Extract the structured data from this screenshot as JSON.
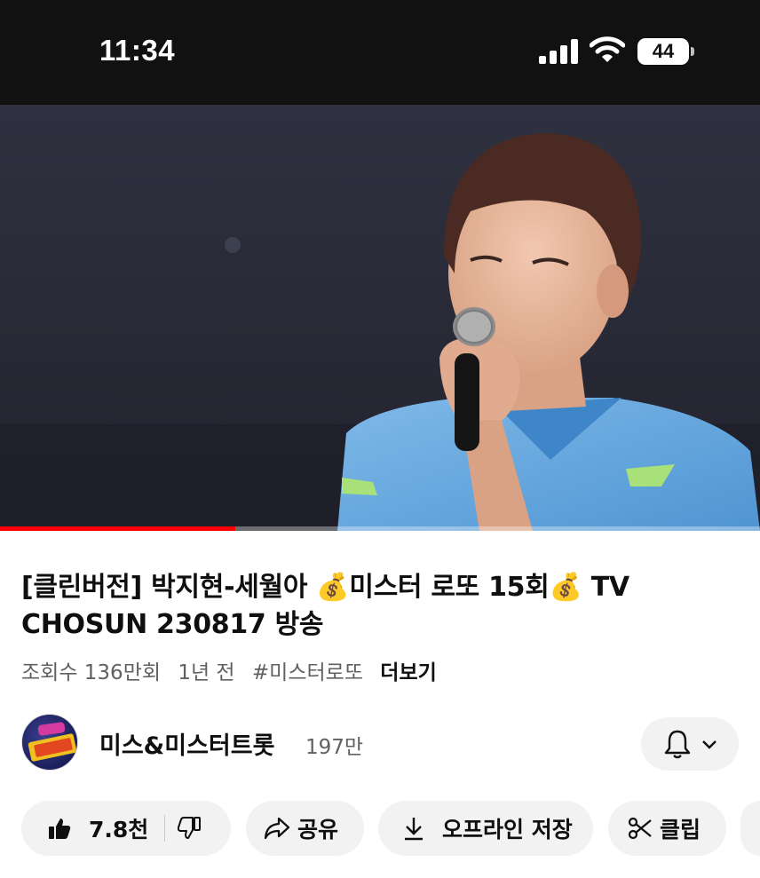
{
  "status_bar": {
    "time": "11:34",
    "battery": "44",
    "icons": [
      "cellular-signal-icon",
      "wifi-icon",
      "battery-icon"
    ]
  },
  "player": {
    "progress_fraction": 0.31,
    "progress_color": "#ff0000"
  },
  "video": {
    "title": "[클린버전] 박지현-세월아 💰미스터 로또 15회💰 TV CHOSUN 230817 방송",
    "views": "조회수 136만회",
    "age": "1년 전",
    "hashtag": "#미스터로또",
    "more": "더보기"
  },
  "channel": {
    "name": "미스&미스터트롯",
    "subscribers": "197만",
    "icons": [
      "channel-avatar",
      "bell-icon",
      "chevron-down-icon"
    ]
  },
  "actions": {
    "likes": "7.8천",
    "share": "공유",
    "download": "오프라인 저장",
    "clip": "클립",
    "icons": [
      "thumbs-up-icon",
      "thumbs-down-icon",
      "share-icon",
      "download-icon",
      "scissors-icon"
    ]
  }
}
